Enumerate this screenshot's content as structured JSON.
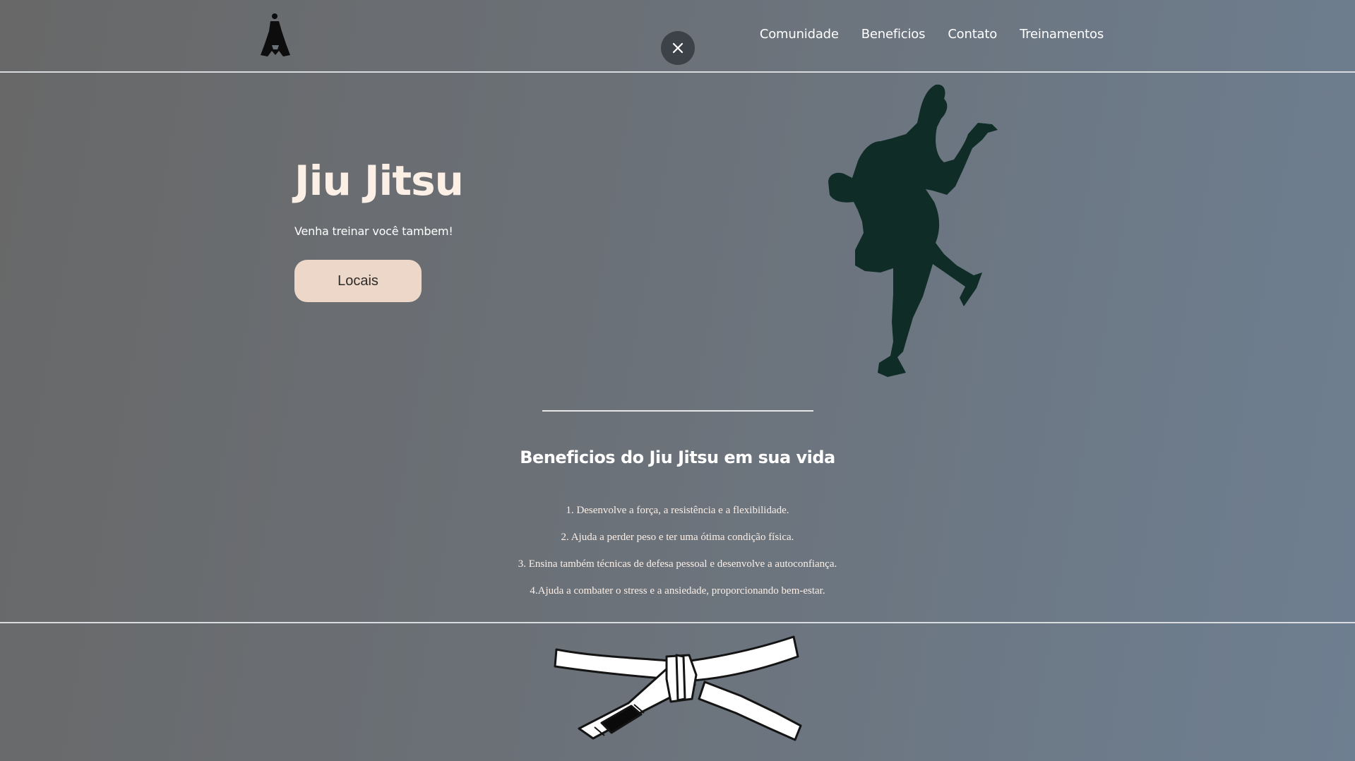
{
  "header": {
    "nav": [
      "Comunidade",
      "Beneficios",
      "Contato",
      "Treinamentos"
    ]
  },
  "hero": {
    "title": "Jiu Jitsu",
    "subtitle": "Venha treinar você tambem!",
    "button_label": "Locais"
  },
  "benefits": {
    "title": "Beneficios do Jiu Jitsu em sua vida",
    "items": [
      "1. Desenvolve a força, a resistência e a flexibilidade.",
      "2. Ajuda a perder peso e ter uma ótima condição física.",
      "3. Ensina também técnicas de defesa pessoal e desenvolve a autoconfiança.",
      "4.Ajuda a combater o stress e a ansiedade, proporcionando bem-estar."
    ]
  },
  "colors": {
    "accent_button": "#ecd7c8",
    "hero_title": "#fbefe6",
    "silhouette": "#0f2c26"
  },
  "icons": {
    "logo": "jiu-jitsu-logo-icon",
    "close": "close-icon",
    "fighter": "fighter-silhouette-icon",
    "belt": "belt-icon"
  }
}
